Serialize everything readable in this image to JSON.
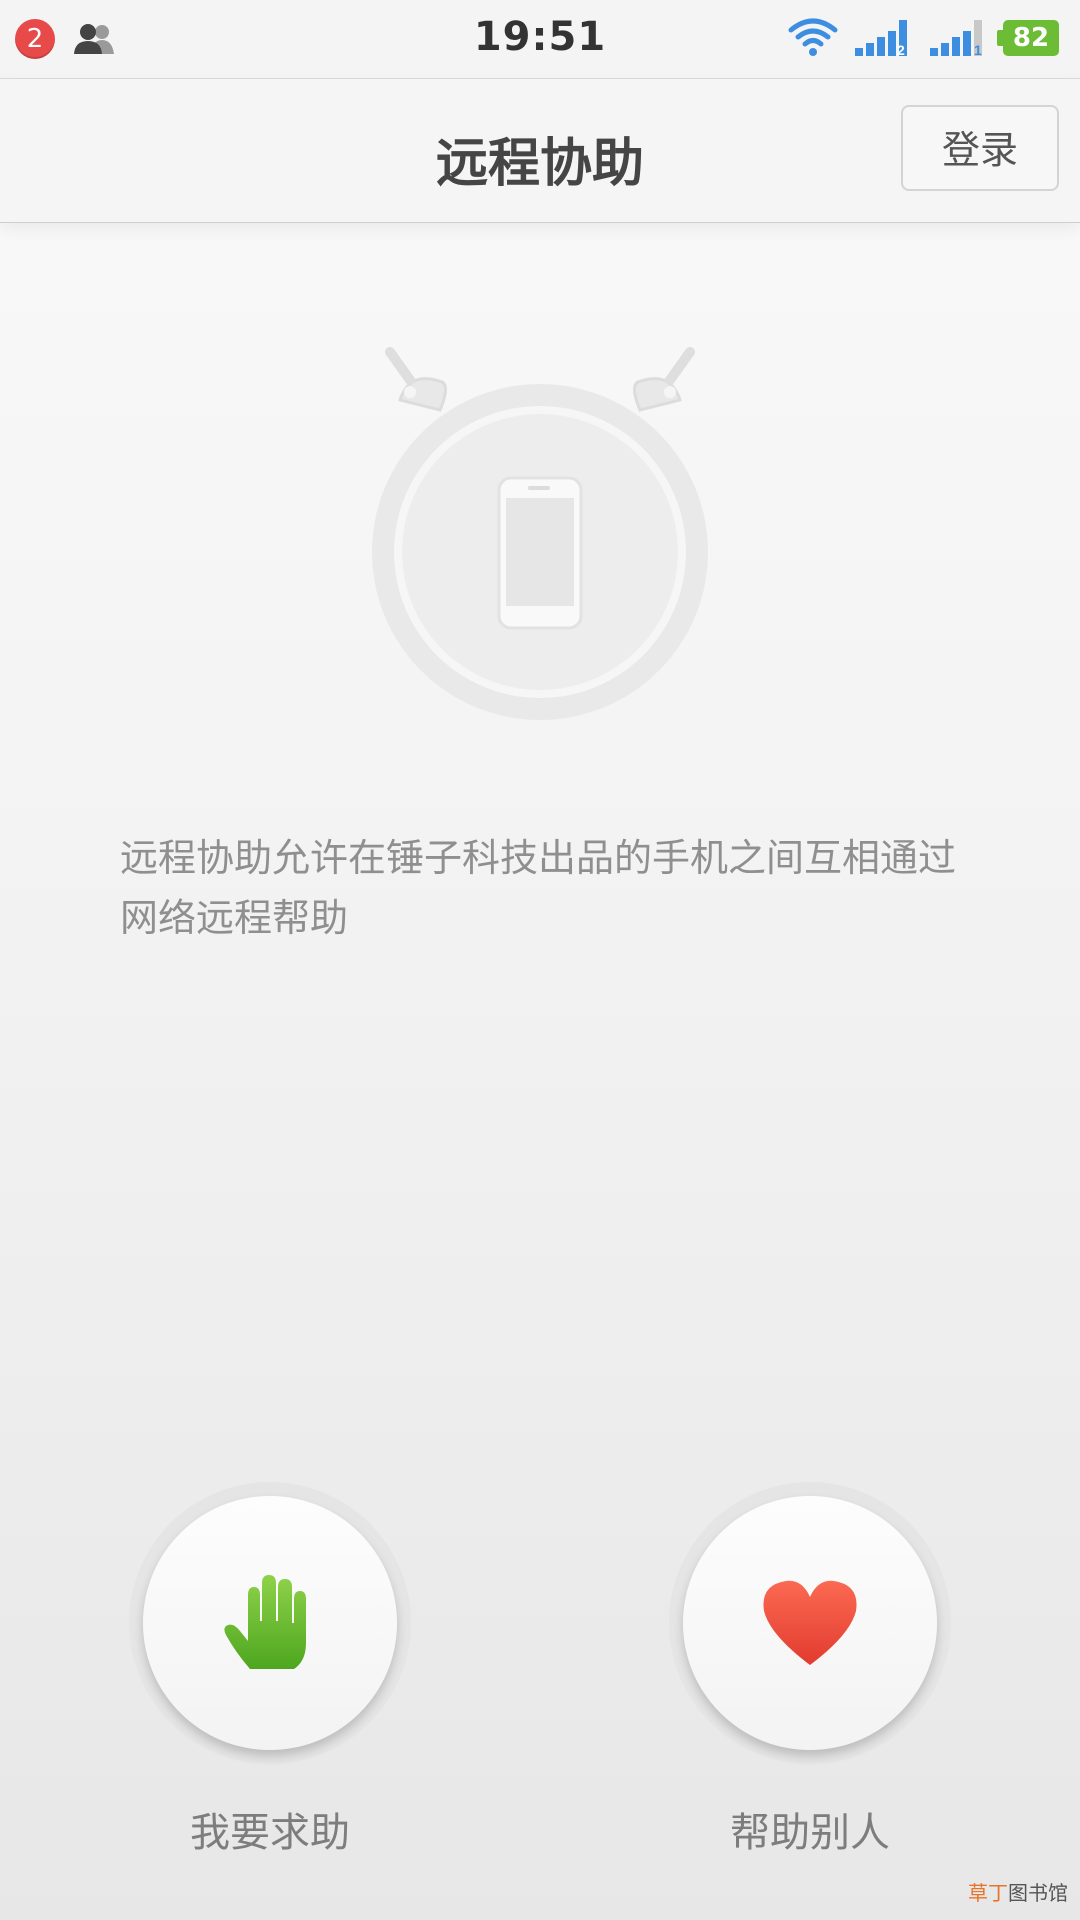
{
  "status_bar": {
    "notification_count": "2",
    "time": "19:51",
    "sim2_label": "2",
    "sim1_label": "1",
    "battery": "82",
    "icons": [
      "contacts-icon",
      "wifi-icon",
      "signal-icon",
      "battery-icon"
    ]
  },
  "header": {
    "title": "远程协助",
    "login_label": "登录"
  },
  "main": {
    "description": "远程协助允许在锤子科技出品的手机之间互相通过网络远程帮助"
  },
  "actions": {
    "request_help_label": "我要求助",
    "help_others_label": "帮助别人"
  },
  "watermark": {
    "part1": "草丁",
    "part2": "图书馆"
  },
  "colors": {
    "badge": "#e84a4a",
    "battery": "#6cbd35",
    "signal": "#3d8ee0",
    "hand": "#6cbd35",
    "heart": "#ee4a3e"
  }
}
